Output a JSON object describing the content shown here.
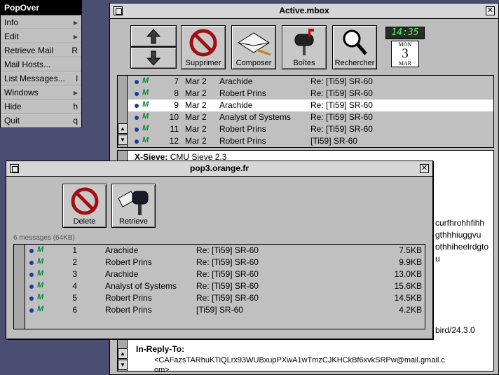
{
  "popover": {
    "title": "PopOver",
    "items": [
      {
        "label": "Info",
        "key": "",
        "submenu": true
      },
      {
        "label": "Edit",
        "key": "",
        "submenu": true
      },
      {
        "label": "Retrieve Mail",
        "key": "R",
        "submenu": false
      },
      {
        "label": "Mail Hosts...",
        "key": "",
        "submenu": false
      },
      {
        "label": "List Messages...",
        "key": "l",
        "submenu": false
      },
      {
        "label": "Windows",
        "key": "",
        "submenu": true
      },
      {
        "label": "Hide",
        "key": "h",
        "submenu": false
      },
      {
        "label": "Quit",
        "key": "q",
        "submenu": false
      }
    ]
  },
  "active": {
    "title": "Active.mbox",
    "toolbar": {
      "delete": "Supprimer",
      "compose": "Composer",
      "boxes": "Boîtes",
      "search": "Rechercher"
    },
    "clock": {
      "time": "14:35",
      "weekday": "MON",
      "day": "3",
      "month": "MAR"
    },
    "messages": [
      {
        "num": "7",
        "date": "Mar 2",
        "from": "Arachide",
        "subject": "Re: [Ti59] SR-60",
        "selected": false
      },
      {
        "num": "8",
        "date": "Mar 2",
        "from": "Robert Prins",
        "subject": "Re: [Ti59] SR-60",
        "selected": false
      },
      {
        "num": "9",
        "date": "Mar 2",
        "from": "Arachide",
        "subject": "Re: [Ti59] SR-60",
        "selected": true
      },
      {
        "num": "10",
        "date": "Mar 2",
        "from": "Analyst of Systems",
        "subject": "Re: [Ti59] SR-60",
        "selected": false
      },
      {
        "num": "11",
        "date": "Mar 2",
        "from": "Robert Prins",
        "subject": "Re: [Ti59] SR-60",
        "selected": false
      },
      {
        "num": "12",
        "date": "Mar 2",
        "from": "Robert Prins",
        "subject": "[Ti59] SR-60",
        "selected": false
      }
    ],
    "body": {
      "sieve_label": "X-Sieve:",
      "sieve_value": "CMU Sieve 2.3",
      "frag1": "curfhrohhfihh",
      "frag2": "gthhhiuggvu",
      "frag3": "othhiheelrdgto",
      "frag4": "u",
      "frag5": "bird/24.3.0",
      "reply_label": "In-Reply-To:",
      "reply_value": "<CAFazsTARhuKTiQLrx93WUBxupPXwA1wTmzCJKHCkBf6xvkSRPw@mail.gmail.c",
      "reply_cont": "om>"
    }
  },
  "pop3": {
    "title": "pop3.orange.fr",
    "toolbar": {
      "delete": "Delete",
      "retrieve": "Retrieve"
    },
    "status": "6 messages (64KB)",
    "messages": [
      {
        "num": "1",
        "from": "Arachide",
        "subject": "Re: [Ti59] SR-60",
        "size": "7.5KB"
      },
      {
        "num": "2",
        "from": "Robert Prins",
        "subject": "Re: [Ti59] SR-60",
        "size": "9.9KB"
      },
      {
        "num": "3",
        "from": "Arachide",
        "subject": "Re: [Ti59] SR-60",
        "size": "13.0KB"
      },
      {
        "num": "4",
        "from": "Analyst of Systems",
        "subject": "Re: [Ti59] SR-60",
        "size": "15.6KB"
      },
      {
        "num": "5",
        "from": "Robert Prins",
        "subject": "Re: [Ti59] SR-60",
        "size": "14.5KB"
      },
      {
        "num": "6",
        "from": "Robert Prins",
        "subject": "[Ti59] SR-60",
        "size": "4.2KB"
      }
    ]
  },
  "colors": {
    "desktop": "#4a4e72",
    "unread_dot": "#1a3aa8",
    "m_flag": "#0a8a3a",
    "clock_lcd": "#4aff5a"
  }
}
